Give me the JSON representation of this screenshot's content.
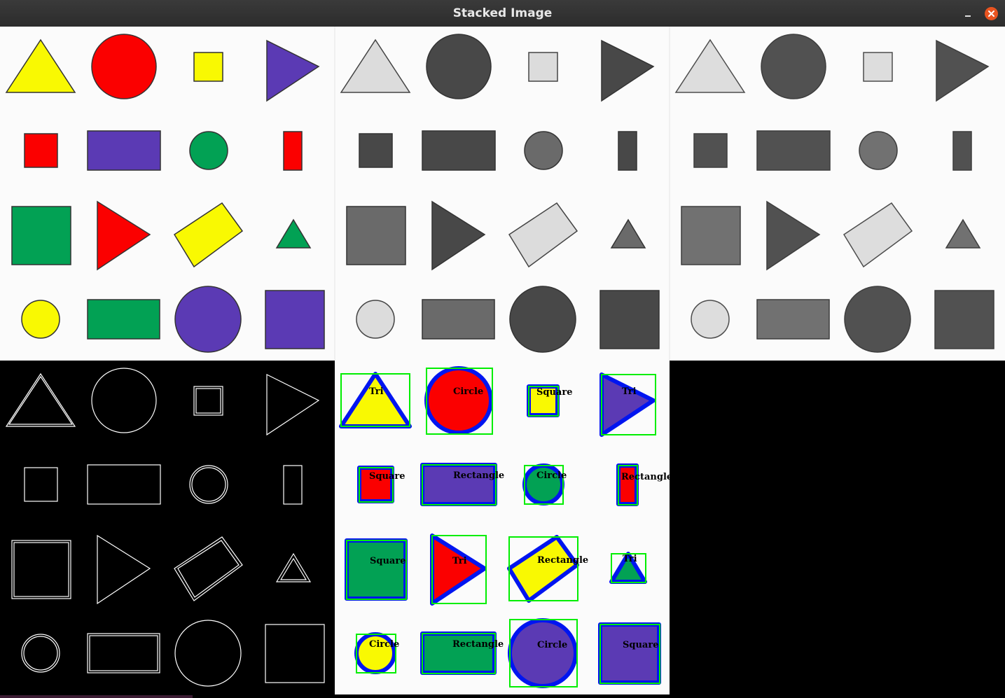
{
  "window": {
    "title": "Stacked Image"
  },
  "icons": {
    "minimize": "minimize-icon",
    "close": "close-icon"
  },
  "colors": {
    "yellow": "#f9f902",
    "red": "#fb0000",
    "purple": "#5b3ab4",
    "green": "#02a154",
    "gray_light": "#dcdcdc",
    "gray_mid": "#6a6a6a",
    "gray_dark": "#484848",
    "contour_blue": "#0015f0",
    "bbox_green": "#00ee00"
  },
  "labels": {
    "r0": [
      "Tri",
      "Circle",
      "Square",
      "Tri"
    ],
    "r1": [
      "Square",
      "Rectangle",
      "Circle",
      "Rectangle"
    ],
    "r2": [
      "Square",
      "Tri",
      "Rectangle",
      "Tri"
    ],
    "r3": [
      "Circle",
      "Rectangle",
      "Circle",
      "Square"
    ]
  }
}
